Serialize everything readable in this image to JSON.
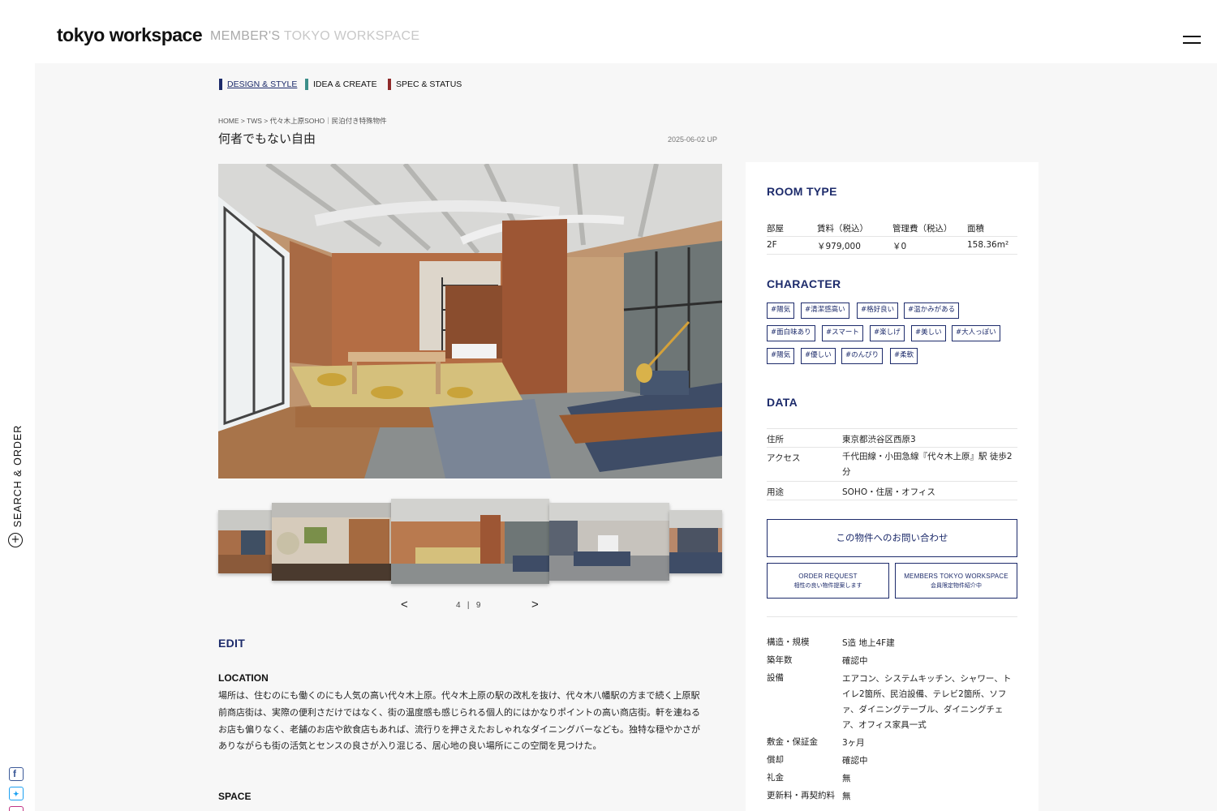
{
  "header": {
    "logo": "tokyo workspace",
    "subbrand_a": "MEMBER'S",
    "subbrand_b": " TOKYO WORKSPACE"
  },
  "sidebar": {
    "search_label": "SEARCH & ORDER",
    "social": [
      "facebook-icon",
      "twitter-icon",
      "instagram-icon"
    ]
  },
  "category_nav": [
    {
      "label": "DESIGN & STYLE",
      "color": "#1d2b6b",
      "active": true
    },
    {
      "label": "IDEA & CREATE",
      "color": "#3d8f8a",
      "active": false
    },
    {
      "label": "SPEC & STATUS",
      "color": "#8f2a2a",
      "active": false
    }
  ],
  "breadcrumb": [
    "HOME",
    "TWS",
    "代々木上原SOHO｜民泊付き特殊物件"
  ],
  "page": {
    "title": "何者でもない自由",
    "date": "2025-06-02 UP"
  },
  "gallery": {
    "current": "4",
    "separator": "|",
    "total": "9",
    "prev": "<",
    "next": ">"
  },
  "edit": {
    "heading": "EDIT",
    "location_heading": "LOCATION",
    "location_text": "場所は、住むのにも働くのにも人気の高い代々木上原。代々木上原の駅の改札を抜け、代々木八幡駅の方まで続く上原駅前商店街は、実際の便利さだけではなく、街の温度感も感じられる個人的にはかなりポイントの高い商店街。軒を連ねるお店も偏りなく、老舗のお店や飲食店もあれば、流行りを押さえたおしゃれなダイニングバーなども。独特な穏やかさがありながらも街の活気とセンスの良さが入り混じる、居心地の良い場所にこの空間を見つけた。",
    "space_heading": "SPACE"
  },
  "room_type": {
    "heading": "ROOM TYPE",
    "headers": [
      "部屋",
      "賃料（税込）",
      "管理費（税込）",
      "面積"
    ],
    "row": [
      "2F",
      "￥979,000",
      "￥0",
      "158.36m²"
    ]
  },
  "character": {
    "heading": "CHARACTER",
    "tags": [
      "#陽気",
      "#清潔感高い",
      "#格好良い",
      "#温かみがある",
      "#面白味あり",
      "#スマート",
      "#楽しげ",
      "#美しい",
      "#大人っぽい",
      "#陽気",
      "#優しい",
      "#のんびり",
      "#柔軟"
    ]
  },
  "data_section": {
    "heading": "DATA",
    "rows": [
      {
        "label": "住所",
        "value": "東京都渋谷区西原3"
      },
      {
        "label": "アクセス",
        "value": "千代田線・小田急線『代々木上原』駅 徒歩2分"
      },
      {
        "label": "用途",
        "value": "SOHO・住居・オフィス"
      }
    ]
  },
  "actions": {
    "inquiry": "この物件へのお問い合わせ",
    "order_title": "ORDER REQUEST",
    "order_sub": "相性の良い物件提案します",
    "members_title": "MEMBERS TOKYO WORKSPACE",
    "members_sub": "会員限定物件紹介中"
  },
  "spec": [
    {
      "label": "構造・規模",
      "value": "S造 地上4F建"
    },
    {
      "label": "築年数",
      "value": "確認中"
    },
    {
      "label": "設備",
      "value": "エアコン、システムキッチン、シャワー、トイレ2箇所、民泊設備、テレビ2箇所、ソファ、ダイニングテーブル、ダイニングチェア、オフィス家具一式"
    },
    {
      "label": "敷金・保証金",
      "value": "3ヶ月"
    },
    {
      "label": "償却",
      "value": "確認中"
    },
    {
      "label": "礼金",
      "value": "無"
    },
    {
      "label": "更新料・再契約料",
      "value": "無"
    }
  ]
}
